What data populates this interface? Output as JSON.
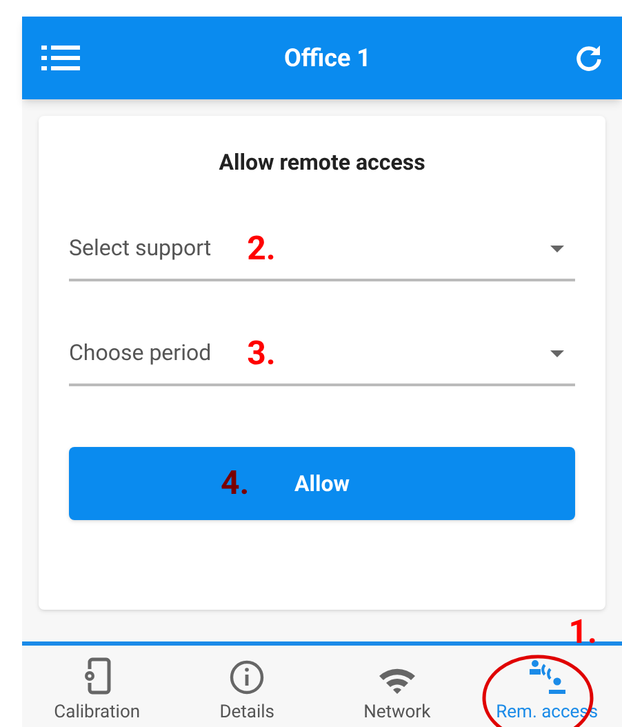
{
  "header": {
    "title": "Office 1"
  },
  "card": {
    "title": "Allow remote access",
    "fields": [
      {
        "placeholder": "Select support",
        "marker": "2."
      },
      {
        "placeholder": "Choose period",
        "marker": "3."
      }
    ],
    "button": {
      "label": "Allow",
      "marker": "4."
    }
  },
  "tabs": [
    {
      "kind": "calibration",
      "label": "Calibration",
      "selected": false
    },
    {
      "kind": "details",
      "label": "Details",
      "selected": false
    },
    {
      "kind": "network",
      "label": "Network",
      "selected": false
    },
    {
      "kind": "remote",
      "label": "Rem. access",
      "selected": true,
      "marker": "1."
    }
  ]
}
